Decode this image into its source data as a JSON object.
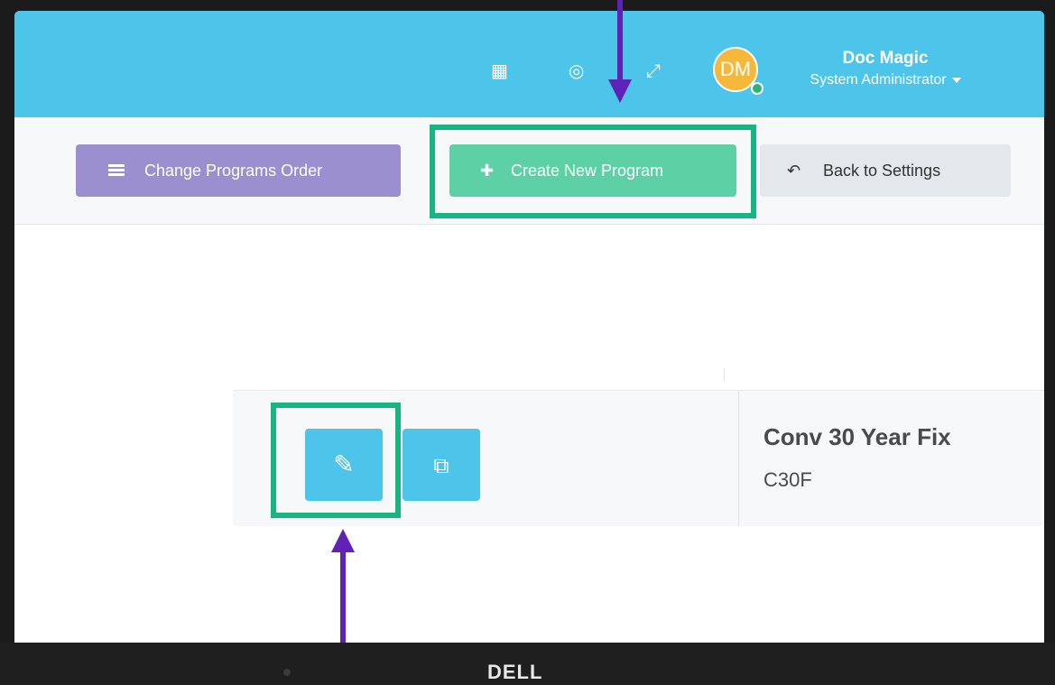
{
  "header": {
    "icons": [
      "calendar-icon",
      "help-icon",
      "fullscreen-icon"
    ],
    "user": {
      "initials": "DM",
      "name": "Doc Magic",
      "role": "System Administrator",
      "status": "online"
    }
  },
  "toolbar": {
    "change_order_label": "Change Programs Order",
    "create_label": "Create New Program",
    "back_label": "Back to Settings"
  },
  "programs": [
    {
      "name": "Conv 30 Year Fix",
      "code": "C30F"
    }
  ],
  "device": {
    "brand": "DELL"
  },
  "colors": {
    "header_bg": "#4dc4ea",
    "order_btn": "#9b8fd0",
    "create_btn": "#5dd0a6",
    "highlight": "#17b584",
    "arrow": "#6021b6"
  }
}
